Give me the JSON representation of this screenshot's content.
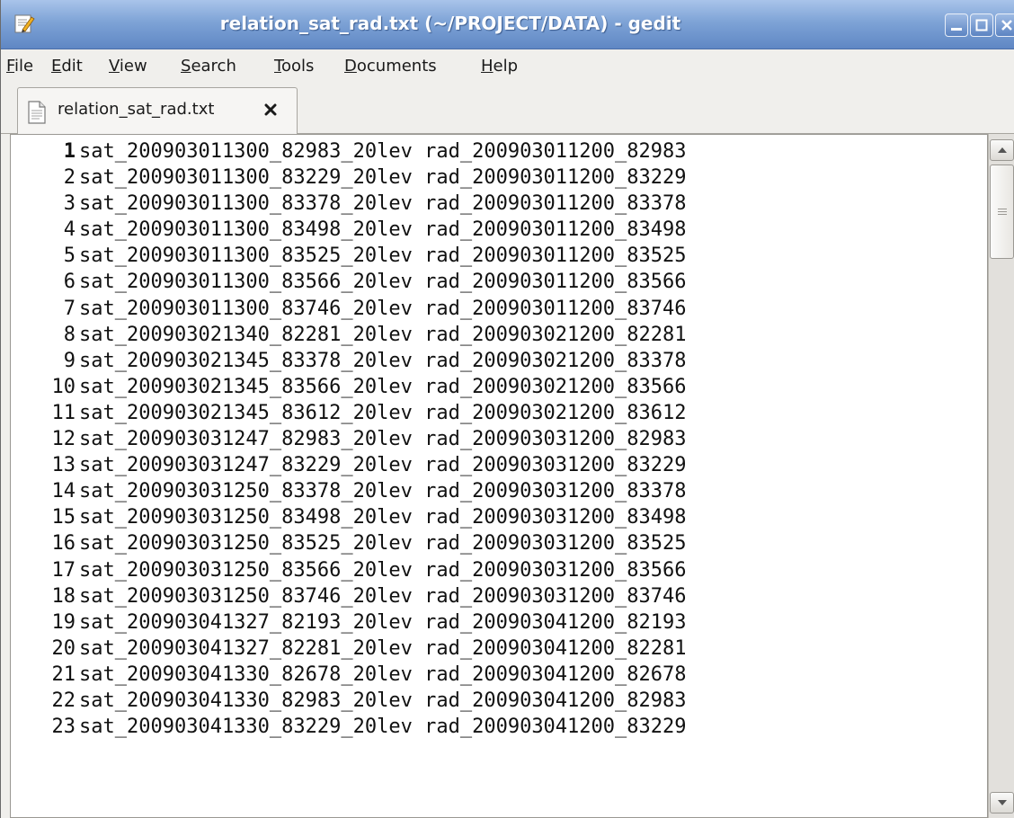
{
  "window": {
    "title": "relation_sat_rad.txt (~/PROJECT/DATA) - gedit"
  },
  "menu": [
    {
      "mnemonic": "F",
      "rest": "ile"
    },
    {
      "mnemonic": "E",
      "rest": "dit"
    },
    {
      "mnemonic": "V",
      "rest": "iew"
    },
    {
      "mnemonic": "S",
      "rest": "earch"
    },
    {
      "mnemonic": "T",
      "rest": "ools"
    },
    {
      "mnemonic": "D",
      "rest": "ocuments"
    },
    {
      "mnemonic": "H",
      "rest": "elp"
    }
  ],
  "tab": {
    "label": "relation_sat_rad.txt",
    "icon": "text-file-icon",
    "close_icon": "close-icon"
  },
  "editor": {
    "current_line": 1,
    "lines": [
      {
        "n": "1",
        "text": "sat_200903011300_82983_20lev rad_200903011200_82983"
      },
      {
        "n": "2",
        "text": "sat_200903011300_83229_20lev rad_200903011200_83229"
      },
      {
        "n": "3",
        "text": "sat_200903011300_83378_20lev rad_200903011200_83378"
      },
      {
        "n": "4",
        "text": "sat_200903011300_83498_20lev rad_200903011200_83498"
      },
      {
        "n": "5",
        "text": "sat_200903011300_83525_20lev rad_200903011200_83525"
      },
      {
        "n": "6",
        "text": "sat_200903011300_83566_20lev rad_200903011200_83566"
      },
      {
        "n": "7",
        "text": "sat_200903011300_83746_20lev rad_200903011200_83746"
      },
      {
        "n": "8",
        "text": "sat_200903021340_82281_20lev rad_200903021200_82281"
      },
      {
        "n": "9",
        "text": "sat_200903021345_83378_20lev rad_200903021200_83378"
      },
      {
        "n": "10",
        "text": "sat_200903021345_83566_20lev rad_200903021200_83566"
      },
      {
        "n": "11",
        "text": "sat_200903021345_83612_20lev rad_200903021200_83612"
      },
      {
        "n": "12",
        "text": "sat_200903031247_82983_20lev rad_200903031200_82983"
      },
      {
        "n": "13",
        "text": "sat_200903031247_83229_20lev rad_200903031200_83229"
      },
      {
        "n": "14",
        "text": "sat_200903031250_83378_20lev rad_200903031200_83378"
      },
      {
        "n": "15",
        "text": "sat_200903031250_83498_20lev rad_200903031200_83498"
      },
      {
        "n": "16",
        "text": "sat_200903031250_83525_20lev rad_200903031200_83525"
      },
      {
        "n": "17",
        "text": "sat_200903031250_83566_20lev rad_200903031200_83566"
      },
      {
        "n": "18",
        "text": "sat_200903031250_83746_20lev rad_200903031200_83746"
      },
      {
        "n": "19",
        "text": "sat_200903041327_82193_20lev rad_200903041200_82193"
      },
      {
        "n": "20",
        "text": "sat_200903041327_82281_20lev rad_200903041200_82281"
      },
      {
        "n": "21",
        "text": "sat_200903041330_82678_20lev rad_200903041200_82678"
      },
      {
        "n": "22",
        "text": "sat_200903041330_82983_20lev rad_200903041200_82983"
      },
      {
        "n": "23",
        "text": "sat_200903041330_83229_20lev rad_200903041200_83229"
      }
    ]
  },
  "colors": {
    "titlebar": "#7ea3d6",
    "window_bg": "#f0efec",
    "editor_bg": "#ffffff"
  }
}
